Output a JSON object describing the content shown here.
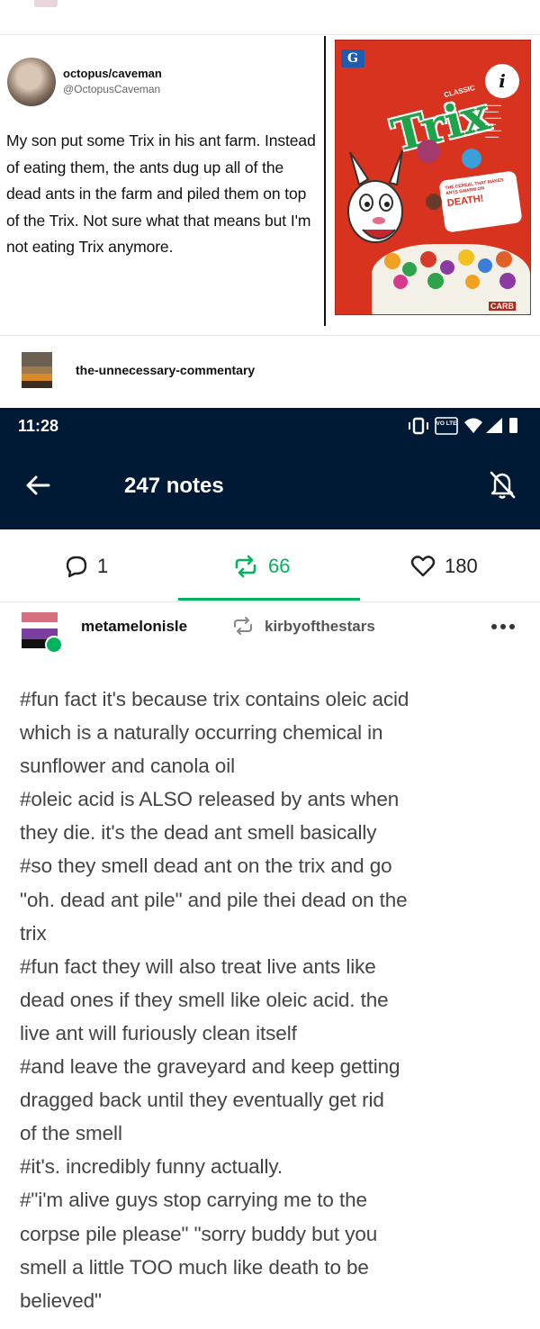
{
  "tweet": {
    "author_name": "octopus/caveman",
    "author_handle": "@OctopusCaveman",
    "text": "My son put some Trix in his ant farm. Instead of eating them, the ants dug up all of the dead ants in the farm and piled them on top of the Trix. Not sure what that means but I'm not eating Trix anymore."
  },
  "cereal_box": {
    "brand_mark": "G",
    "info_symbol": "i",
    "logo": "Trix",
    "classic_label": "CLASSIC",
    "bubble_small": "THE CEREAL THAT MAKES ANTS SWARM ON",
    "bubble_big": "DEATH!",
    "brand_tag": "CARB"
  },
  "reblogger": {
    "name": "the-unnecessary-commentary"
  },
  "status_bar": {
    "time": "11:28",
    "icons": [
      "vibrate-icon",
      "volte-icon",
      "wifi-icon",
      "signal-icon",
      "battery-icon"
    ],
    "volte_label": "VO LTE"
  },
  "app_bar": {
    "title": "247 notes",
    "background": "#001935"
  },
  "tabs": [
    {
      "icon": "comment-icon",
      "count": "1"
    },
    {
      "icon": "reblog-icon",
      "count": "66",
      "active": true
    },
    {
      "icon": "heart-icon",
      "count": "180"
    }
  ],
  "accent_color": "#00b35c",
  "note": {
    "user": "metamelonisle",
    "reblogged_from": "kirbyofthestars",
    "tags": [
      "#fun fact it's because trix contains oleic acid",
      "which is a naturally occurring chemical in",
      "sunflower and canola oil",
      "#oleic acid is ALSO released by ants when",
      "they die. it's the dead ant smell basically",
      "#so they smell dead ant on the trix and go",
      "\"oh. dead ant pile\" and pile thei dead on the",
      "trix",
      "#fun fact they will also treat live ants like",
      "dead ones if they smell like oleic acid. the",
      "live ant will furiously clean itself",
      "#and leave the graveyard and keep getting",
      "dragged back until they eventually get rid",
      "of the smell",
      "#it's. incredibly funny actually.",
      "#\"i'm alive guys stop carrying me to the",
      "corpse pile please\" \"sorry buddy but you",
      "smell a little TOO much like death to be",
      "believed\""
    ]
  }
}
